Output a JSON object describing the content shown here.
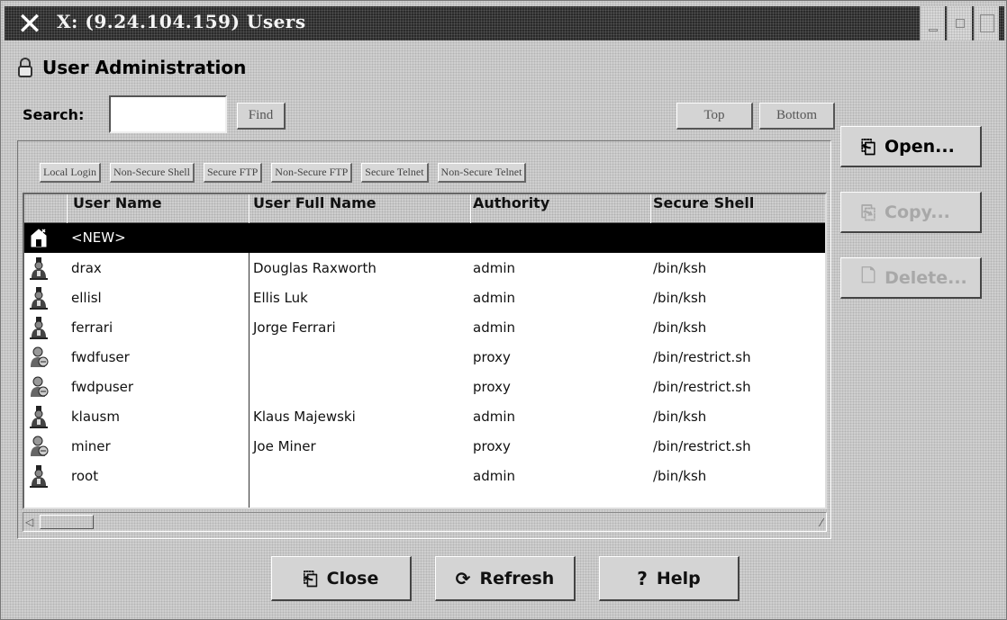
{
  "window": {
    "title": "X: (9.24.104.159) Users"
  },
  "header": {
    "title": "User Administration",
    "icon": "lock-icon"
  },
  "search": {
    "label": "Search:",
    "value": "",
    "find_label": "Find"
  },
  "nav": {
    "top_label": "Top",
    "bottom_label": "Bottom"
  },
  "column_toggles": [
    "Local Login",
    "Non-Secure Shell",
    "Secure FTP",
    "Non-Secure FTP",
    "Secure Telnet",
    "Non-Secure Telnet"
  ],
  "table": {
    "columns": [
      "User Name",
      "User Full Name",
      "Authority",
      "Secure Shell"
    ],
    "new_row": "<NEW>",
    "rows": [
      {
        "user": "drax",
        "full_name": "Douglas Raxworth",
        "authority": "admin",
        "shell": "/bin/ksh",
        "icon": "admin-user-icon"
      },
      {
        "user": "ellisl",
        "full_name": "Ellis Luk",
        "authority": "admin",
        "shell": "/bin/ksh",
        "icon": "admin-user-icon"
      },
      {
        "user": "ferrari",
        "full_name": "Jorge Ferrari",
        "authority": "admin",
        "shell": "/bin/ksh",
        "icon": "admin-user-icon"
      },
      {
        "user": "fwdfuser",
        "full_name": "",
        "authority": "proxy",
        "shell": "/bin/restrict.sh",
        "icon": "proxy-user-icon"
      },
      {
        "user": "fwdpuser",
        "full_name": "",
        "authority": "proxy",
        "shell": "/bin/restrict.sh",
        "icon": "proxy-user-icon"
      },
      {
        "user": "klausm",
        "full_name": "Klaus Majewski",
        "authority": "admin",
        "shell": "/bin/ksh",
        "icon": "admin-user-icon"
      },
      {
        "user": "miner",
        "full_name": "Joe Miner",
        "authority": "proxy",
        "shell": "/bin/restrict.sh",
        "icon": "proxy-user-icon"
      },
      {
        "user": "root",
        "full_name": "",
        "authority": "admin",
        "shell": "/bin/ksh",
        "icon": "admin-user-icon"
      }
    ]
  },
  "actions": {
    "open_label": "Open...",
    "copy_label": "Copy...",
    "delete_label": "Delete..."
  },
  "footer": {
    "close_label": "Close",
    "refresh_label": "Refresh",
    "help_label": "Help"
  },
  "colors": {
    "selection": "#000000",
    "window_bg": "#cfcfcf",
    "titlebar_bg": "#2a2a2a"
  }
}
